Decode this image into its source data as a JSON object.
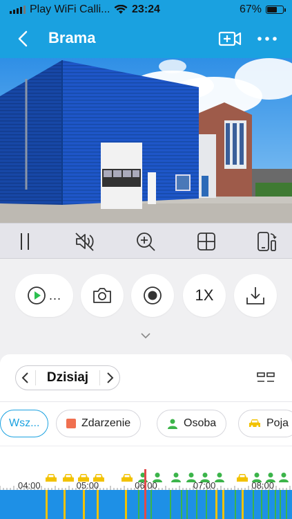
{
  "status_bar": {
    "carrier": "Play WiFi Calli...",
    "time": "23:24",
    "battery": "67%",
    "battery_level": 0.67
  },
  "nav": {
    "title": "Brama"
  },
  "player": {
    "speed_label": "1X",
    "play_label_suffix": "..."
  },
  "date_nav": {
    "label": "Dzisiaj"
  },
  "filters": [
    {
      "label": "Wsz...",
      "active": true
    },
    {
      "label": "Zdarzenie",
      "icon": "event-square-icon",
      "color": "#f07050"
    },
    {
      "label": "Osoba",
      "icon": "person-icon",
      "color": "#3cb44a"
    },
    {
      "label": "Poja",
      "icon": "car-icon",
      "color": "#f2c200"
    }
  ],
  "timeline": {
    "ticks": [
      {
        "label": "04:00",
        "pos": 0.1
      },
      {
        "label": "05:00",
        "pos": 0.3
      },
      {
        "label": "06:00",
        "pos": 0.5
      },
      {
        "label": "07:00",
        "pos": 0.7
      },
      {
        "label": "08:00",
        "pos": 0.9
      }
    ],
    "cursor_time": "06:00",
    "colors": {
      "track": "#1e90e6",
      "person": "#3cb44a",
      "vehicle": "#f2c200",
      "cursor": "#e24a4a"
    }
  }
}
